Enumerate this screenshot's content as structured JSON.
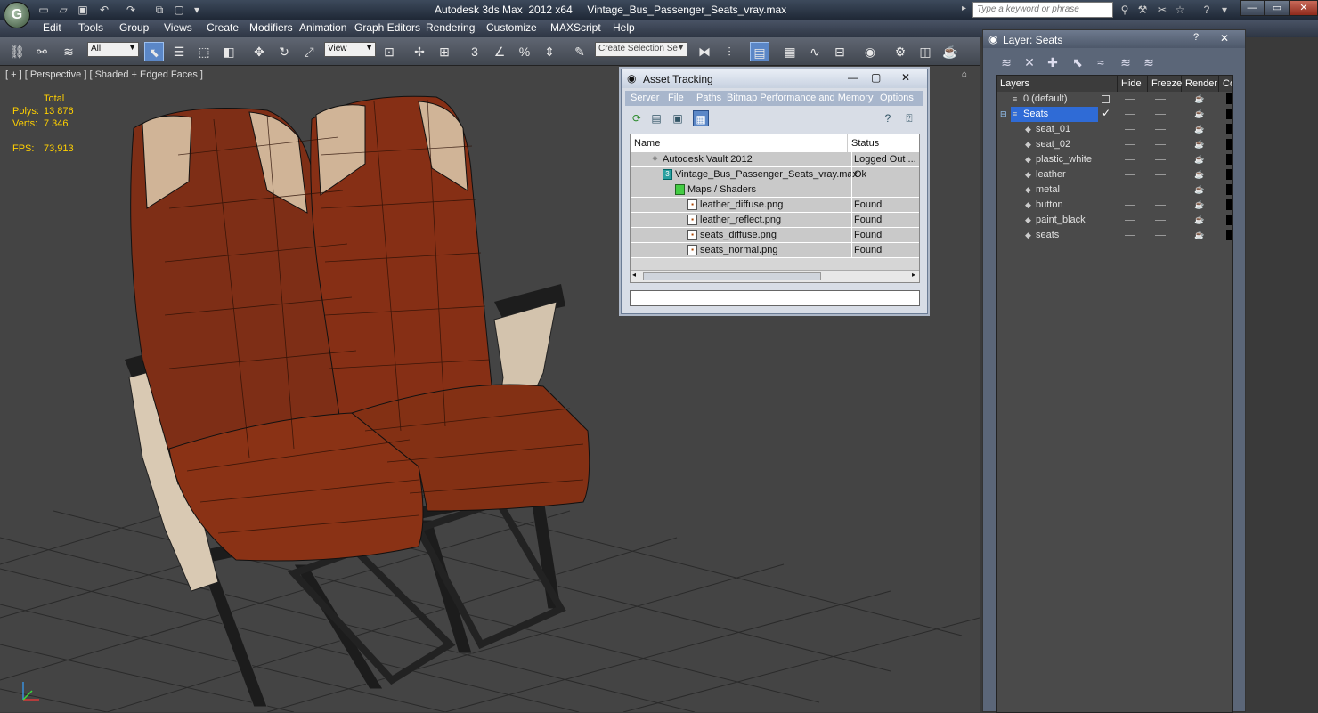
{
  "app": {
    "title": "Autodesk 3ds Max  2012 x64     Vintage_Bus_Passenger_Seats_vray.max",
    "search_placeholder": "Type a keyword or phrase"
  },
  "menu": [
    "Edit",
    "Tools",
    "Group",
    "Views",
    "Create",
    "Modifiers",
    "Animation",
    "Graph Editors",
    "Rendering",
    "Customize",
    "MAXScript",
    "Help"
  ],
  "toolbar": {
    "selection_filter": "All",
    "ref_coord": "View",
    "named_selection_placeholder": "Create Selection Se"
  },
  "viewport": {
    "label": "[ + ] [ Perspective ] [ Shaded + Edged Faces ]",
    "stats_header": "Total",
    "polys_label": "Polys:",
    "polys_value": "13 876",
    "verts_label": "Verts:",
    "verts_value": "7 346",
    "fps_label": "FPS:",
    "fps_value": "73,913"
  },
  "asset_tracking": {
    "title": "Asset Tracking",
    "menu": [
      "Server",
      "File",
      "Paths",
      "Bitmap Performance and Memory",
      "Options"
    ],
    "columns": [
      "Name",
      "Status"
    ],
    "rows": [
      {
        "name": "Autodesk Vault 2012",
        "status": "Logged Out ..."
      },
      {
        "name": "Vintage_Bus_Passenger_Seats_vray.max",
        "status": "Ok"
      },
      {
        "name": "Maps / Shaders",
        "status": ""
      },
      {
        "name": "leather_diffuse.png",
        "status": "Found"
      },
      {
        "name": "leather_reflect.png",
        "status": "Found"
      },
      {
        "name": "seats_diffuse.png",
        "status": "Found"
      },
      {
        "name": "seats_normal.png",
        "status": "Found"
      }
    ]
  },
  "layers": {
    "title": "Layer: Seats",
    "columns": [
      "Layers",
      "Hide",
      "Freeze",
      "Render",
      "Col"
    ],
    "rows": [
      {
        "name": "0 (default)"
      },
      {
        "name": "Seats"
      },
      {
        "name": "seat_01"
      },
      {
        "name": "seat_02"
      },
      {
        "name": "plastic_white"
      },
      {
        "name": "leather"
      },
      {
        "name": "metal"
      },
      {
        "name": "button"
      },
      {
        "name": "paint_black"
      },
      {
        "name": "seats"
      }
    ],
    "selected_color": "#2f6bd6"
  }
}
